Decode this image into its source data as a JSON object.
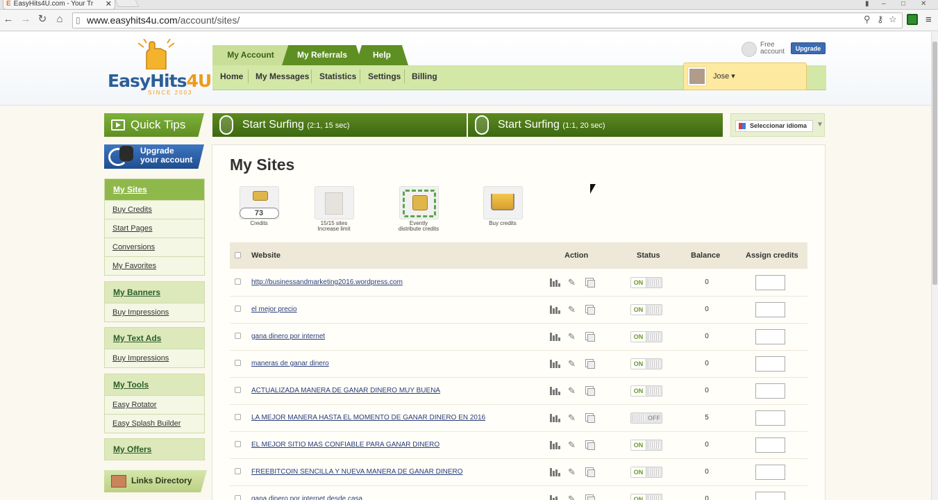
{
  "browser": {
    "tab_title": "EasyHits4U.com - Your Tr",
    "url_host": "www.easyhits4u.com",
    "url_path": "/account/sites/"
  },
  "logo": {
    "main": "EasyHits",
    "accent": "4U",
    "since": "SINCE 2003"
  },
  "account": {
    "type_line1": "Free",
    "type_line2": "account",
    "upgrade_label": "Upgrade"
  },
  "main_tabs": [
    {
      "label": "My Account",
      "active": true
    },
    {
      "label": "My Referrals"
    },
    {
      "label": "Help"
    }
  ],
  "subnav": [
    "Home",
    "My Messages",
    "Statistics",
    "Settings",
    "Billing"
  ],
  "user": {
    "name": "Jose ▾"
  },
  "quick_tips": "Quick Tips",
  "upgrade_account": {
    "line1": "Upgrade",
    "line2": "your account"
  },
  "surf_buttons": [
    {
      "label": "Start Surfing",
      "detail": "(2:1, 15 sec)"
    },
    {
      "label": "Start Surfing",
      "detail": "(1:1, 20 sec)"
    }
  ],
  "language": {
    "label": "Seleccionar idioma",
    "caret": "▼"
  },
  "sidebar": [
    {
      "title": "My Sites",
      "active": true,
      "items": [
        "Buy Credits",
        "Start Pages",
        "Conversions",
        "My Favorites"
      ]
    },
    {
      "title": "My Banners",
      "items": [
        "Buy Impressions"
      ]
    },
    {
      "title": "My Text Ads",
      "items": [
        "Buy Impressions"
      ]
    },
    {
      "title": "My Tools",
      "items": [
        "Easy Rotator",
        "Easy Splash Builder"
      ]
    },
    {
      "title": "My Offers",
      "items": []
    }
  ],
  "links_directory": "Links Directory",
  "page_title": "My Sites",
  "stats": [
    {
      "value": "73",
      "label_line1": "Credits",
      "label_line2": ""
    },
    {
      "value": "",
      "label_line1": "15/15 sites",
      "label_line2": "Increase limit"
    },
    {
      "value": "",
      "label_line1": "Evently",
      "label_line2": "distribute credits"
    },
    {
      "value": "",
      "label_line1": "Buy credits",
      "label_line2": ""
    }
  ],
  "table": {
    "headers": {
      "website": "Website",
      "action": "Action",
      "status": "Status",
      "balance": "Balance",
      "assign": "Assign credits"
    },
    "rows": [
      {
        "url": "http://businessandmarketing2016.wordpress.com",
        "status": "ON",
        "balance": "0"
      },
      {
        "url": "el mejor precio",
        "status": "ON",
        "balance": "0"
      },
      {
        "url": "gana dinero por internet",
        "status": "ON",
        "balance": "0"
      },
      {
        "url": "maneras de ganar dinero",
        "status": "ON",
        "balance": "0"
      },
      {
        "url": "ACTUALIZADA MANERA DE GANAR DINERO MUY BUENA",
        "status": "ON",
        "balance": "0"
      },
      {
        "url": "LA MEJOR MANERA HASTA EL MOMENTO DE GANAR DINERO EN 2016",
        "status": "OFF",
        "balance": "5"
      },
      {
        "url": "EL MEJOR SITIO MAS CONFIABLE PARA GANAR DINERO",
        "status": "ON",
        "balance": "0"
      },
      {
        "url": "FREEBITCOIN SENCILLA Y NUEVA MANERA DE GANAR DINERO",
        "status": "ON",
        "balance": "0"
      },
      {
        "url": "gana dinero por internet desde casa",
        "status": "ON",
        "balance": "0"
      }
    ]
  },
  "colors": {
    "brand_green": "#5e8f22",
    "brand_blue": "#2c5f97",
    "accent_orange": "#ef9b1b",
    "on_green": "#6a9a23"
  }
}
